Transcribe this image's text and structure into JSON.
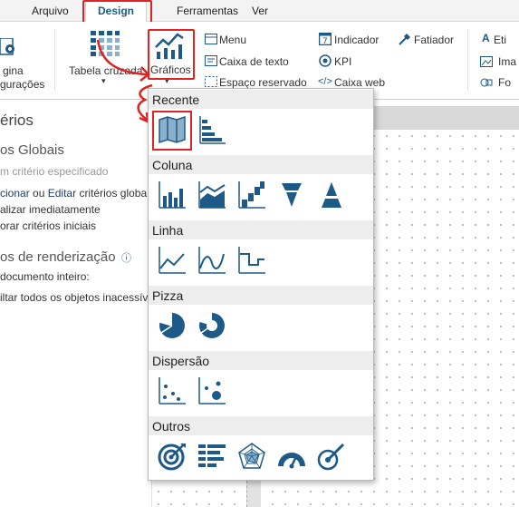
{
  "menu": {
    "items": [
      "Arquivo",
      "Design",
      "Ferramentas",
      "Ver"
    ],
    "active": "Design"
  },
  "ribbon": {
    "page_settings_line1": "gina",
    "page_settings_line2": "gurações",
    "cross_table": "Tabela cruzada",
    "charts": "Gráficos",
    "menu": "Menu",
    "text_box": "Caixa de texto",
    "placeholder": "Espaço reservado",
    "indicator": "Indicador",
    "kpi": "KPI",
    "web_box": "Caixa web",
    "slicer": "Fatiador",
    "label_cut": "Eti",
    "image_cut": "Ima",
    "shape_cut": "Fo"
  },
  "left_panel": {
    "title": "érios",
    "global_criteria": "os Globais",
    "no_criteria": "m critério especificado",
    "select_edit_prefix": "cionar",
    "select_edit_or": "ou",
    "select_edit_edit": "Editar",
    "select_edit_suffix": "critérios globa",
    "update_now": "alizar imediatamente",
    "reset_initial": "orar critérios iniciais",
    "render_options": "os de renderização",
    "whole_doc": "documento inteiro:",
    "render_all": "iltar todos os objetos inacessív"
  },
  "dropdown": {
    "categories": [
      "Recente",
      "Coluna",
      "Linha",
      "Pizza",
      "Dispersão",
      "Outros"
    ],
    "icons": {
      "recent": [
        "map-chart-icon",
        "horizontal-bar-chart-icon"
      ],
      "column": [
        "column-chart-icon",
        "area-column-chart-icon",
        "step-column-chart-icon",
        "funnel-chart-icon",
        "pyramid-chart-icon"
      ],
      "line": [
        "line-chart-icon",
        "smooth-line-chart-icon",
        "step-line-chart-icon"
      ],
      "pie": [
        "pie-chart-icon",
        "donut-chart-icon"
      ],
      "scatter": [
        "scatter-chart-icon",
        "bubble-chart-icon"
      ],
      "other": [
        "target-chart-icon",
        "table-bar-chart-icon",
        "radar-chart-icon",
        "gauge-chart-icon",
        "dial-chart-icon"
      ]
    }
  },
  "colors": {
    "icon": "#1d5a87",
    "highlight": "#e02424",
    "category_bg": "#ededed"
  }
}
